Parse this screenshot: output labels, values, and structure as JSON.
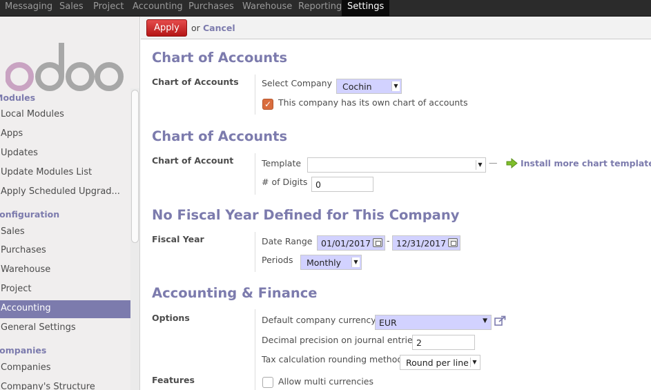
{
  "topbar": {
    "items": [
      "Messaging",
      "Sales",
      "Project",
      "Accounting",
      "Purchases",
      "Warehouse",
      "Reporting",
      "Settings"
    ],
    "active": "Settings"
  },
  "sidebar": {
    "logo_text": "odoo",
    "sections": [
      {
        "title": "Modules",
        "items": [
          "Local Modules",
          "Apps",
          "Updates",
          "Update Modules List",
          "Apply Scheduled Upgrad..."
        ]
      },
      {
        "title": "Configuration",
        "items": [
          "Sales",
          "Purchases",
          "Warehouse",
          "Project",
          "Accounting",
          "General Settings"
        ]
      },
      {
        "title": "Companies",
        "items": [
          "Companies",
          "Company's Structure"
        ]
      }
    ],
    "active_item": "Accounting"
  },
  "actions": {
    "apply": "Apply",
    "or": "or",
    "cancel": "Cancel"
  },
  "sections": {
    "company": {
      "heading": "Chart of Accounts",
      "label": "Chart of Accounts",
      "select_company_label": "Select Company",
      "select_company_value": "Cochin",
      "own_chart_label": "This company has its own chart of accounts",
      "own_chart_checked": true
    },
    "chart": {
      "heading": "Chart of Accounts",
      "label": "Chart of Account",
      "template_label": "Template",
      "template_value": "",
      "install_link": "Install more chart templates",
      "digits_label": "# of Digits",
      "digits_value": "0"
    },
    "fiscal": {
      "heading": "No Fiscal Year Defined for This Company",
      "label": "Fiscal Year",
      "date_range_label": "Date Range",
      "date_from": "01/01/2017",
      "date_sep": "-",
      "date_to": "12/31/2017",
      "periods_label": "Periods",
      "periods_value": "Monthly"
    },
    "finance": {
      "heading": "Accounting & Finance",
      "options_label": "Options",
      "currency_label": "Default company currency",
      "currency_value": "EUR",
      "decimal_label": "Decimal precision on journal entries",
      "decimal_value": "2",
      "rounding_label": "Tax calculation rounding method",
      "rounding_value": "Round per line",
      "features_label": "Features",
      "multi_currency_label": "Allow multi currencies",
      "multi_currency_checked": false
    }
  },
  "colors": {
    "accent": "#7c7bad",
    "apply": "#c92424",
    "checkbox": "#d96d3e"
  }
}
